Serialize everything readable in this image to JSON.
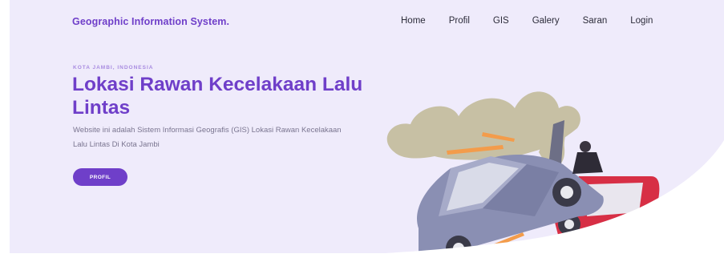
{
  "nav": {
    "brand": "Geographic Information System.",
    "links": [
      "Home",
      "Profil",
      "GIS",
      "Galery",
      "Saran",
      "Login"
    ]
  },
  "hero": {
    "eyebrow": "KOTA JAMBI, INDONESIA",
    "title": "Lokasi Rawan Kecelakaan Lalu Lintas",
    "description": "Website ini adalah Sistem Informasi Geografis (GIS) Lokasi Rawan Kecelakaan Lalu Lintas Di Kota Jambi",
    "button_label": "PROFIL"
  },
  "colors": {
    "hero_bg": "#efebfb",
    "accent": "#6f3fc9",
    "eyebrow": "#a88be0",
    "text_muted": "#7a7590"
  },
  "illustration": {
    "icon": "car-crash-illustration"
  }
}
